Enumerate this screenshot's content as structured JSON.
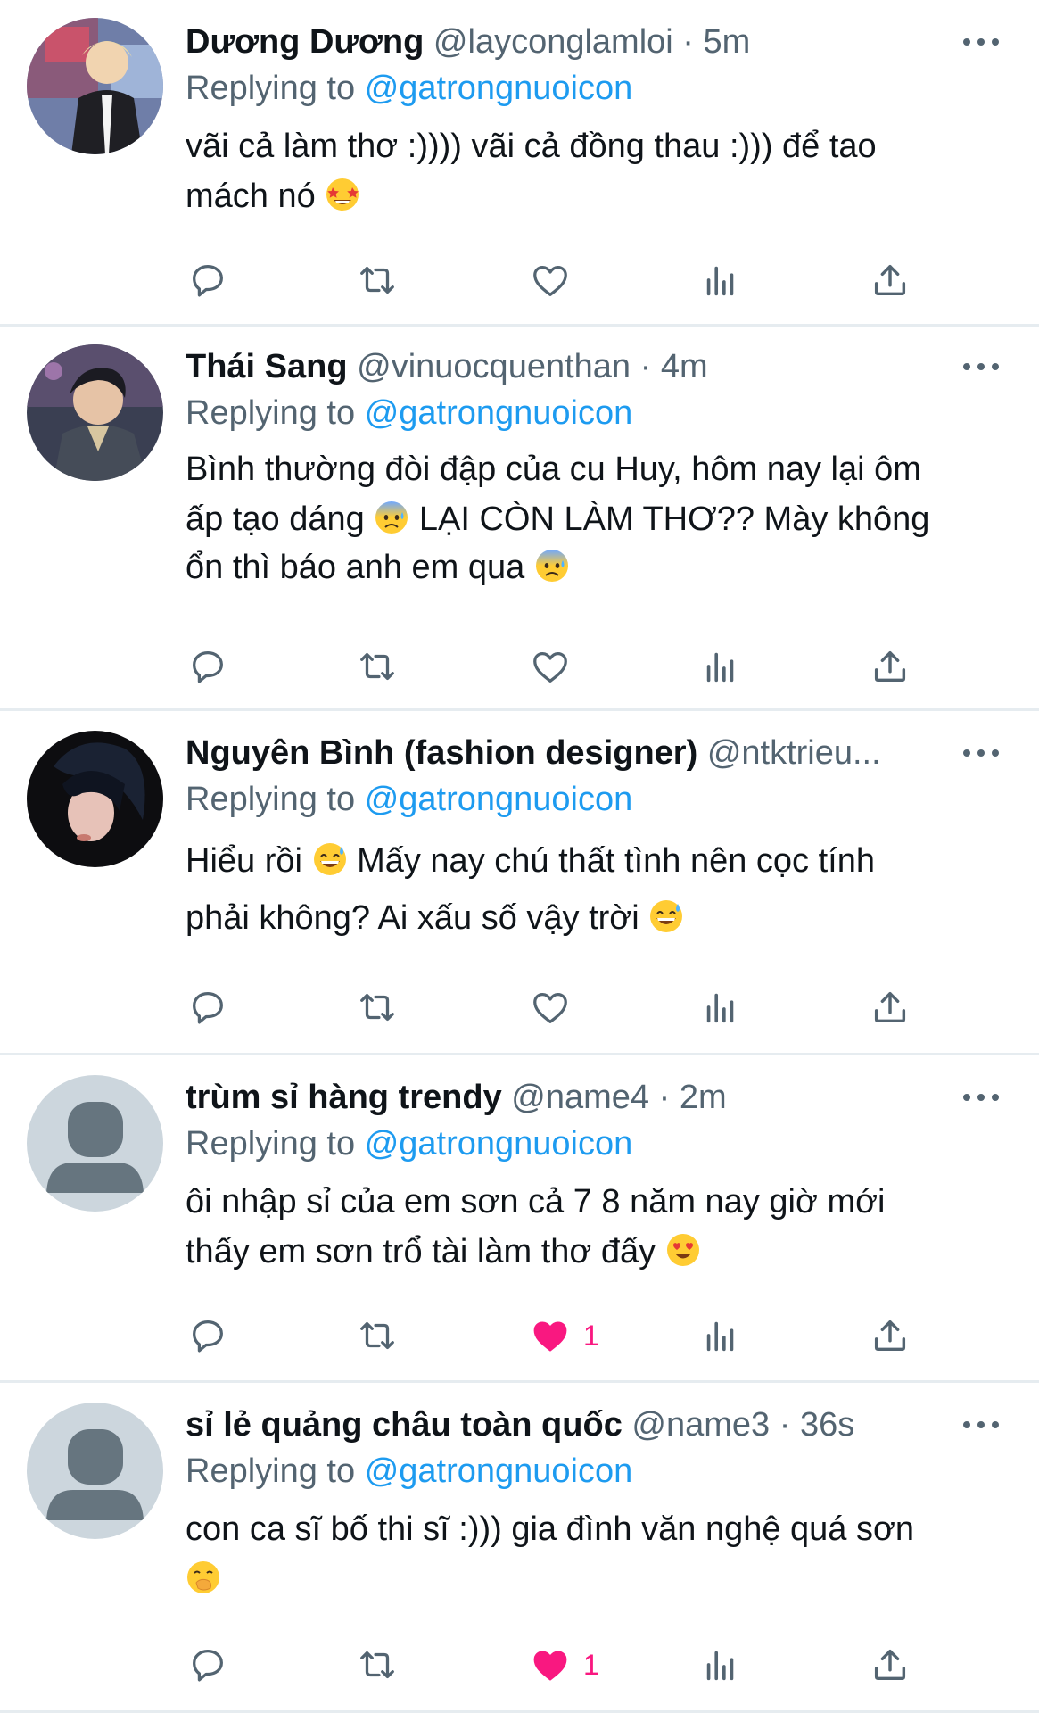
{
  "tweets": [
    {
      "name": "Dương Dương",
      "handle": "@layconglamloi",
      "dot": "·",
      "time": "5m",
      "reply_prefix": "Replying to",
      "reply_to": "@gatrongnuoicon",
      "lines": [
        "vãi cả làm thơ :)))) vãi cả đồng thau :))) để tao",
        "mách nó"
      ],
      "emojis": [
        "star-struck-emoji"
      ],
      "liked": false,
      "like_count": ""
    },
    {
      "name": "Thái Sang",
      "handle": "@vinuocquenthan",
      "dot": "·",
      "time": "4m",
      "reply_prefix": "Replying to",
      "reply_to": "@gatrongnuoicon",
      "lines": [
        "Bình thường đòi đập của cu Huy, hôm nay lại ôm",
        "ấp tạo dáng",
        "LẠI CÒN LÀM THƠ?? Mày không",
        "ổn thì báo anh em qua"
      ],
      "emojis": [
        "anxious-face-emoji",
        "anxious-face-emoji"
      ],
      "liked": false,
      "like_count": ""
    },
    {
      "name": "Nguyên Bình (fashion designer)",
      "handle": "@ntktrieu...",
      "reply_prefix": "Replying to",
      "reply_to": "@gatrongnuoicon",
      "lines": [
        "Hiểu rồi",
        "Mấy nay chú thất tình nên cọc tính",
        "phải không? Ai xấu số vậy trời"
      ],
      "emojis": [
        "grinning-sweat-emoji",
        "grinning-sweat-emoji"
      ],
      "liked": false,
      "like_count": ""
    },
    {
      "name": "trùm sỉ hàng trendy",
      "handle": "@name4",
      "dot": "·",
      "time": "2m",
      "reply_prefix": "Replying to",
      "reply_to": "@gatrongnuoicon",
      "lines": [
        "ôi nhập sỉ của em sơn cả 7 8 năm nay giờ mới",
        "thấy em sơn trổ tài làm thơ đấy"
      ],
      "emojis": [
        "heart-eyes-emoji"
      ],
      "liked": true,
      "like_count": "1"
    },
    {
      "name": "sỉ lẻ quảng châu toàn quốc",
      "handle": "@name3",
      "dot": "·",
      "time": "36s",
      "reply_prefix": "Replying to",
      "reply_to": "@gatrongnuoicon",
      "lines": [
        "con ca sĩ bố thi sĩ :))) gia đình văn nghệ quá sơn"
      ],
      "emojis": [
        "hand-over-mouth-emoji"
      ],
      "liked": true,
      "like_count": "1"
    }
  ],
  "colors": {
    "accent": "#1d9bf0",
    "secondary_text": "#536471",
    "like": "#f91880",
    "divider": "#e6ecf0"
  },
  "icons": [
    "reply-icon",
    "retweet-icon",
    "like-icon",
    "analytics-icon",
    "share-icon",
    "more-icon"
  ]
}
